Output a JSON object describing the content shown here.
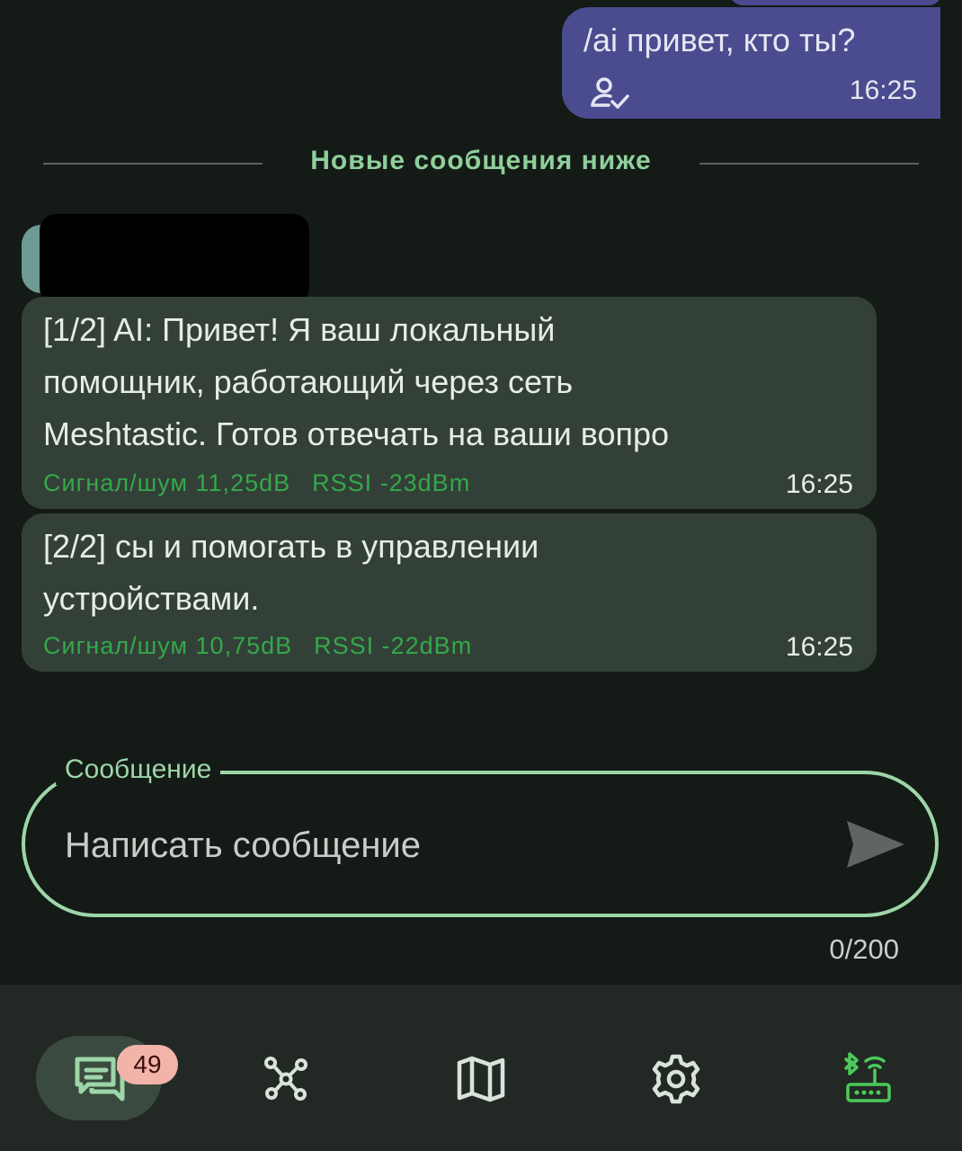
{
  "outgoing": {
    "text": "/ai привет, кто ты?",
    "time": "16:25",
    "status_icon": "person-check-icon"
  },
  "divider": {
    "label": "Новые сообщения ниже"
  },
  "incoming": [
    {
      "lines": [
        "[1/2] AI: Привет! Я ваш локальный",
        "помощник, работающий через сеть",
        "Meshtastic. Готов отвечать на ваши вопро"
      ],
      "snr": "Сигнал/шум 11,25dB",
      "rssi": "RSSI -23dBm",
      "time": "16:25"
    },
    {
      "lines": [
        "[2/2] сы и помогать в управлении",
        "устройствами."
      ],
      "snr": "Сигнал/шум 10,75dB",
      "rssi": "RSSI -22dBm",
      "time": "16:25"
    }
  ],
  "composer": {
    "label": "Сообщение",
    "placeholder": "Написать сообщение",
    "counter": "0/200",
    "send_icon": "send-icon"
  },
  "nav": {
    "items": [
      {
        "id": "messages",
        "icon": "chat-icon",
        "active": true,
        "badge": "49"
      },
      {
        "id": "nodes",
        "icon": "nodes-icon"
      },
      {
        "id": "map",
        "icon": "map-icon"
      },
      {
        "id": "settings",
        "icon": "gear-icon"
      },
      {
        "id": "connection",
        "icon": "bluetooth-router-icon"
      }
    ]
  },
  "colors": {
    "background": "#141a16",
    "outgoing_bubble": "#4a4c8f",
    "incoming_bubble": "#334038",
    "accent_green": "#9dd6a8",
    "signal_green": "#34a84a",
    "badge": "#f2b3a9",
    "nav_bar": "#222925"
  }
}
